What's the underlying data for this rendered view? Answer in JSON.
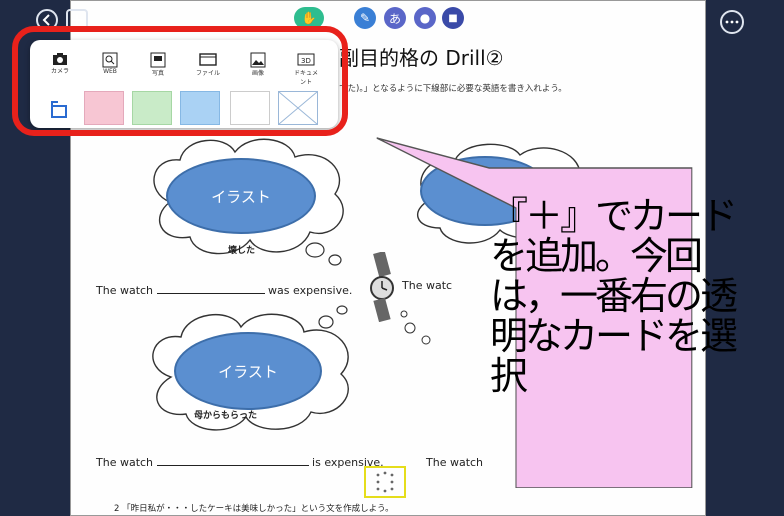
{
  "header": {
    "back_icon": "arrow-left-icon",
    "add_icon": "plus-icon",
    "more_icon": "ellipsis-icon",
    "tools": [
      {
        "name": "hand-tool",
        "color": "#2ebd8f",
        "glyph": "✋"
      },
      {
        "name": "pen-tool",
        "color": "#3a7fd5",
        "glyph": "✎"
      },
      {
        "name": "kana-tool",
        "color": "#5a66c8",
        "glyph": "あ"
      },
      {
        "name": "mic-tool",
        "color": "#5a66c8",
        "glyph": "●"
      },
      {
        "name": "stop-tool",
        "color": "#3a4aa8",
        "glyph": "■"
      }
    ]
  },
  "popup": {
    "items": [
      {
        "icon": "camera-icon",
        "label": "カメラ"
      },
      {
        "icon": "web-search-icon",
        "label": "WEB"
      },
      {
        "icon": "image-card-icon",
        "label": "写真"
      },
      {
        "icon": "web-page-icon",
        "label": "ファイル"
      },
      {
        "icon": "picture-icon",
        "label": "画像"
      },
      {
        "icon": "3d-icon",
        "label": "ドキュメント"
      }
    ],
    "rotate_icon": "rotate-icon",
    "swatches": [
      {
        "name": "pink-card",
        "color": "#f7c6d3"
      },
      {
        "name": "green-card",
        "color": "#c9ebc8"
      },
      {
        "name": "blue-card",
        "color": "#aad2f4"
      },
      {
        "name": "white-card",
        "color": "#ffffff"
      },
      {
        "name": "transparent-card",
        "color": "transparent"
      }
    ]
  },
  "document": {
    "title": "副目的格の Drill②",
    "instruction": "でた)。」となるように下線部に必要な英語を書き入れよう。",
    "illust_label": "イラスト",
    "bubble1_caption": "壊した",
    "bubble2_caption": "母からもらった",
    "sentence1_start": "The watch",
    "sentence1_end": "was expensive.",
    "sentence1b": "The watc",
    "sentence2_start": "The watch",
    "sentence2_end": "is expensive.",
    "sentence2b": "The watch",
    "footer_note": "2 「昨日私が・・・したケーキは美味しかった」という文を作成しよう。"
  },
  "callout": {
    "text": "『＋』でカードを追加。今回は，一番右の透明なカードを選択"
  },
  "colors": {
    "frame": "#1f2a44",
    "highlight": "#e8211b",
    "callout_fill": "#f7c4f0",
    "illust": "#5b8fd0"
  }
}
